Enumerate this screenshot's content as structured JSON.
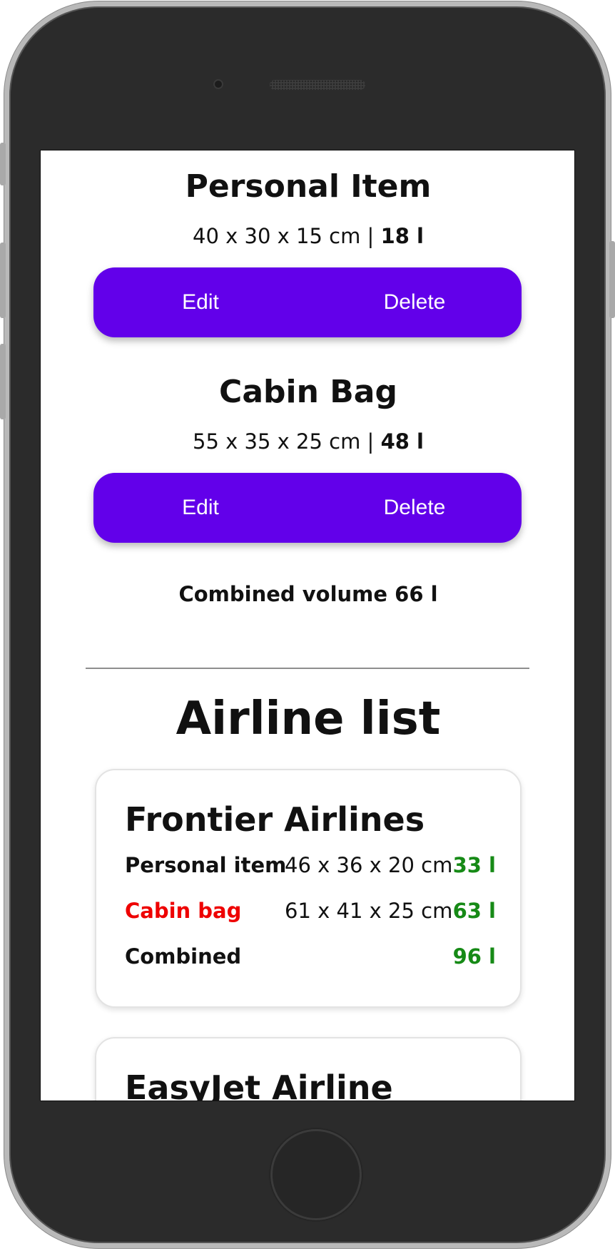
{
  "bags": [
    {
      "title": "Personal Item",
      "dims": "40 x 30 x 15 cm",
      "separator": " | ",
      "volume": "18 l",
      "edit_label": "Edit",
      "delete_label": "Delete"
    },
    {
      "title": "Cabin Bag",
      "dims": "55 x 35 x 25 cm",
      "separator": " | ",
      "volume": "48 l",
      "edit_label": "Edit",
      "delete_label": "Delete"
    }
  ],
  "combined_volume": "Combined volume 66 l",
  "airline_section": {
    "title": "Airline list",
    "airlines": [
      {
        "name": "Frontier Airlines",
        "rows": [
          {
            "label": "Personal item",
            "dims": "46 x 36 x 20 cm",
            "volume": "33 l",
            "fits": true
          },
          {
            "label": "Cabin bag",
            "dims": "61 x 41 x 25 cm",
            "volume": "63 l",
            "fits": false
          },
          {
            "label": "Combined",
            "dims": "",
            "volume": "96 l",
            "fits": true
          }
        ]
      },
      {
        "name": "EasyJet Airline"
      }
    ]
  },
  "colors": {
    "accent": "#6200ea",
    "ok": "#168a16",
    "alert": "#ee0000"
  }
}
